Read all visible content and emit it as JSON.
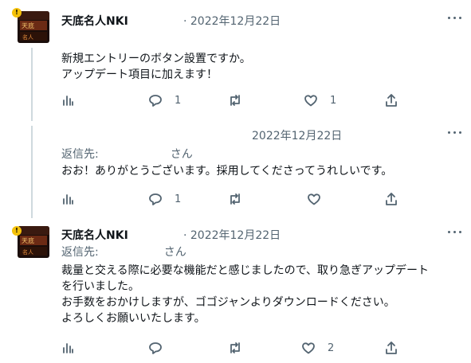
{
  "tweets": [
    {
      "author": "天底名人NKI",
      "date": "· 2022年12月22日",
      "badge": "!",
      "text": "新規エントリーのボタン設置ですか。\nアップデート項目に加えます！",
      "replies": "1",
      "likes": "1"
    },
    {
      "date": "2022年12月22日",
      "reply_to_label": "返信先:",
      "reply_to_suffix": "さん",
      "text": "おお！ありがとうございます。採用してくださってうれしいです。",
      "replies": "1"
    },
    {
      "author": "天底名人NKI",
      "date": "· 2022年12月22日",
      "reply_to_label": "返信先:",
      "reply_to_suffix": "さん",
      "text": "裁量と交える際に必要な機能だと感じましたので、取り急ぎアップデート\nを行いました。\nお手数をおかけしますが、ゴゴジャンよりダウンロードください。\nよろしくお願いいたします。",
      "likes": "2"
    }
  ],
  "icons": [
    "analytics-icon",
    "reply-icon",
    "retweet-icon",
    "like-icon",
    "share-icon",
    "more-icon"
  ],
  "colors": {
    "text": "#0f1419",
    "muted": "#536471",
    "thread_line": "#cfd9de",
    "badge": "#f4c10a"
  }
}
